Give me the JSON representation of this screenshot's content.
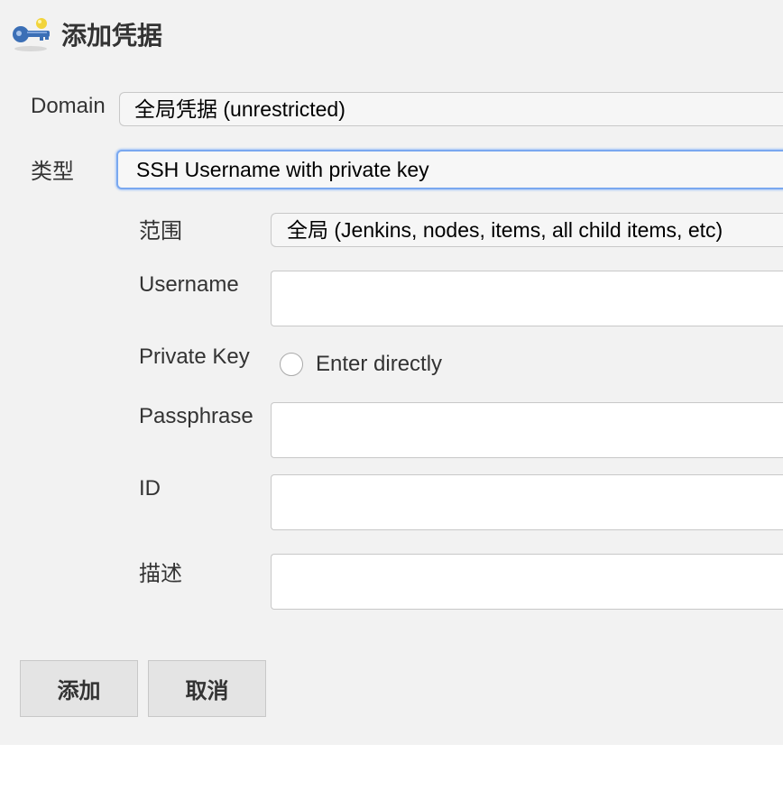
{
  "header": {
    "title": "添加凭据",
    "icon": "key-icon"
  },
  "form": {
    "domain_label": "Domain",
    "domain_value": "全局凭据 (unrestricted)",
    "kind_label": "类型",
    "kind_value": "SSH Username with private key",
    "scope_label": "范围",
    "scope_value": "全局 (Jenkins, nodes, items, all child items, etc)",
    "username_label": "Username",
    "username_value": "",
    "private_key_label": "Private Key",
    "private_key_option": "Enter directly",
    "passphrase_label": "Passphrase",
    "passphrase_value": "",
    "id_label": "ID",
    "id_value": "",
    "description_label": "描述",
    "description_value": ""
  },
  "buttons": {
    "add_label": "添加",
    "cancel_label": "取消"
  },
  "colors": {
    "panel_bg": "#f2f2f2",
    "focus_border": "#7aa8f0",
    "key_blue": "#3b6fb6",
    "key_yellow": "#f2d43b"
  }
}
